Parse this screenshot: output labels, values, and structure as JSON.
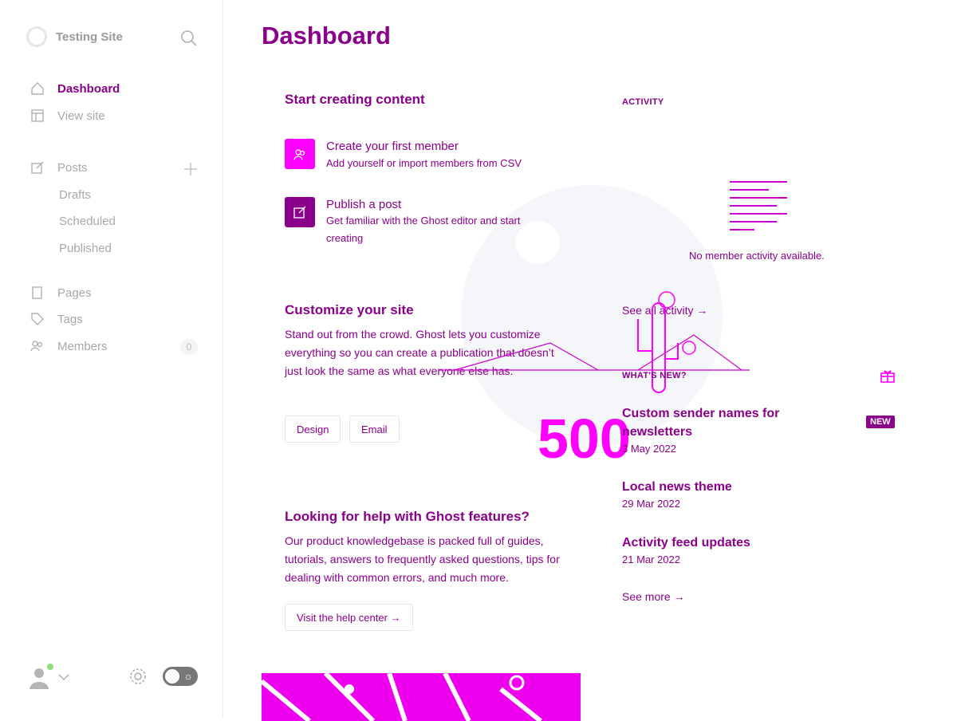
{
  "site": {
    "name": "Testing Site"
  },
  "sidebar": {
    "items": [
      {
        "label": "Dashboard"
      },
      {
        "label": "View site"
      },
      {
        "label": "Posts"
      },
      {
        "label": "Drafts"
      },
      {
        "label": "Scheduled"
      },
      {
        "label": "Published"
      },
      {
        "label": "Pages"
      },
      {
        "label": "Tags"
      },
      {
        "label": "Members",
        "count": "0"
      }
    ],
    "footer": {
      "user_icon": "avatar-icon",
      "settings_icon": "gear-icon",
      "theme_toggle": "dark-mode-toggle"
    }
  },
  "page": {
    "title": "Dashboard"
  },
  "start": {
    "heading": "Start creating content",
    "items": [
      {
        "title": "Create your first member",
        "desc": "Add yourself or import members from CSV",
        "color": "#ff00ff"
      },
      {
        "title": "Publish a post",
        "desc": "Get familiar with the Ghost editor and start creating",
        "color": "#8b008b"
      }
    ]
  },
  "customize": {
    "heading": "Customize your site",
    "text": "Stand out from the crowd. Ghost lets you customize everything so you can create a publication that doesn’t just look the same as what everyone else has.",
    "buttons": [
      "Design",
      "Email"
    ]
  },
  "help": {
    "heading": "Looking for help with Ghost features?",
    "text": "Our product knowledgebase is packed full of guides, tutorials, answers to frequently asked questions, tips for dealing with common errors, and much more.",
    "button": "Visit the help center →"
  },
  "activity": {
    "label": "ACTIVITY",
    "empty": "No member activity available.",
    "link": "See all activity →"
  },
  "whats_new": {
    "label": "WHAT'S NEW?",
    "badge": "NEW",
    "items": [
      {
        "title": "Custom sender names for newsletters",
        "date": "3 May 2022"
      },
      {
        "title": "Local news theme",
        "date": "29 Mar 2022"
      },
      {
        "title": "Activity feed updates",
        "date": "21 Mar 2022"
      }
    ],
    "more": "See more →"
  },
  "overlay": {
    "error_code": "500"
  },
  "colors": {
    "accent": "#8b008b",
    "accent_bright": "#ff00ff",
    "muted": "#a8a8a8"
  }
}
